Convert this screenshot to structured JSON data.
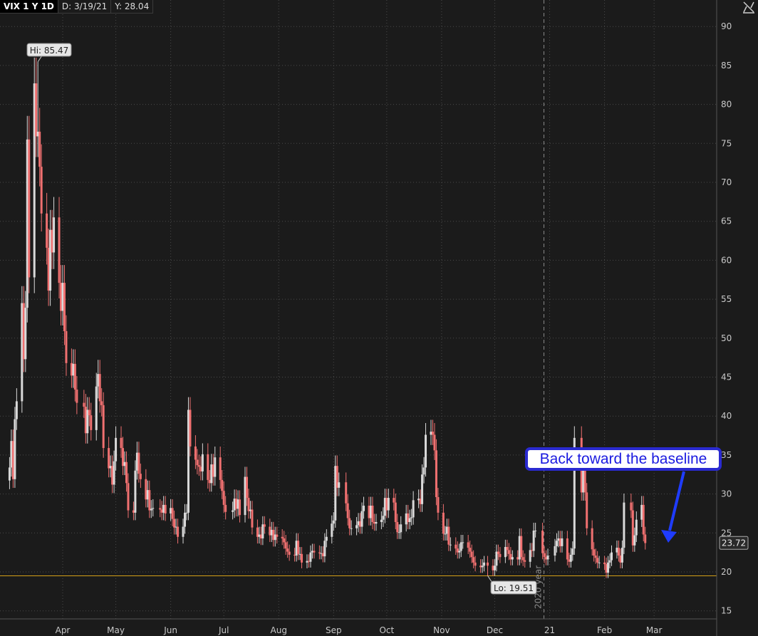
{
  "header": {
    "symbol": "VIX 1 Y 1D",
    "date": "D: 3/19/21",
    "value": "Y: 28.04"
  },
  "annotation": {
    "text": "Back toward the baseline",
    "color": "#1a1ae0"
  },
  "colors": {
    "background": "#1b1b1b",
    "grid": "#4a4a4a",
    "up": "#d9d9d9",
    "down": "#f07070",
    "support_line": "#d4a017",
    "arrow": "#1f3cff"
  },
  "chart_data": {
    "type": "candlestick",
    "title": "VIX 1 Y 1D",
    "xlabel": "",
    "ylabel": "",
    "ylim": [
      14.5,
      92
    ],
    "yticks": [
      15,
      20,
      25,
      30,
      35,
      40,
      45,
      50,
      55,
      60,
      65,
      70,
      75,
      80,
      85,
      90
    ],
    "month_labels": [
      "Apr",
      "May",
      "Jun",
      "Jul",
      "Aug",
      "Sep",
      "Oct",
      "Nov",
      "Dec",
      "21",
      "Feb",
      "Mar"
    ],
    "year_separator_label": "2020 year",
    "grid": true,
    "hi": {
      "label": "Hi: 85.47",
      "value": 85.47,
      "date": "2020-03-18"
    },
    "lo": {
      "label": "Lo: 19.51",
      "value": 19.51,
      "date": "2020-11-27"
    },
    "last_price": {
      "label": "23.72",
      "value": 23.72
    },
    "support_level": 19.5,
    "dates": [
      "2020-03-02",
      "2020-03-03",
      "2020-03-04",
      "2020-03-05",
      "2020-03-06",
      "2020-03-09",
      "2020-03-10",
      "2020-03-11",
      "2020-03-12",
      "2020-03-13",
      "2020-03-16",
      "2020-03-17",
      "2020-03-18",
      "2020-03-19",
      "2020-03-20",
      "2020-03-23",
      "2020-03-24",
      "2020-03-25",
      "2020-03-26",
      "2020-03-27",
      "2020-03-30",
      "2020-03-31",
      "2020-04-01",
      "2020-04-02",
      "2020-04-03",
      "2020-04-06",
      "2020-04-07",
      "2020-04-08",
      "2020-04-09",
      "2020-04-13",
      "2020-04-14",
      "2020-04-15",
      "2020-04-16",
      "2020-04-17",
      "2020-04-20",
      "2020-04-21",
      "2020-04-22",
      "2020-04-23",
      "2020-04-24",
      "2020-04-27",
      "2020-04-28",
      "2020-04-29",
      "2020-04-30",
      "2020-05-01",
      "2020-05-04",
      "2020-05-05",
      "2020-05-06",
      "2020-05-07",
      "2020-05-08",
      "2020-05-11",
      "2020-05-12",
      "2020-05-13",
      "2020-05-14",
      "2020-05-15",
      "2020-05-18",
      "2020-05-19",
      "2020-05-20",
      "2020-05-21",
      "2020-05-22",
      "2020-05-26",
      "2020-05-27",
      "2020-05-28",
      "2020-05-29",
      "2020-06-01",
      "2020-06-02",
      "2020-06-03",
      "2020-06-04",
      "2020-06-05",
      "2020-06-08",
      "2020-06-09",
      "2020-06-10",
      "2020-06-11",
      "2020-06-12",
      "2020-06-15",
      "2020-06-16",
      "2020-06-17",
      "2020-06-18",
      "2020-06-19",
      "2020-06-22",
      "2020-06-23",
      "2020-06-24",
      "2020-06-25",
      "2020-06-26",
      "2020-06-29",
      "2020-06-30",
      "2020-07-01",
      "2020-07-02",
      "2020-07-06",
      "2020-07-07",
      "2020-07-08",
      "2020-07-09",
      "2020-07-10",
      "2020-07-13",
      "2020-07-14",
      "2020-07-15",
      "2020-07-16",
      "2020-07-17",
      "2020-07-20",
      "2020-07-21",
      "2020-07-22",
      "2020-07-23",
      "2020-07-24",
      "2020-07-27",
      "2020-07-28",
      "2020-07-29",
      "2020-07-30",
      "2020-07-31",
      "2020-08-03",
      "2020-08-04",
      "2020-08-05",
      "2020-08-06",
      "2020-08-07",
      "2020-08-10",
      "2020-08-11",
      "2020-08-12",
      "2020-08-13",
      "2020-08-14",
      "2020-08-17",
      "2020-08-18",
      "2020-08-19",
      "2020-08-20",
      "2020-08-21",
      "2020-08-24",
      "2020-08-25",
      "2020-08-26",
      "2020-08-27",
      "2020-08-28",
      "2020-08-31",
      "2020-09-01",
      "2020-09-02",
      "2020-09-03",
      "2020-09-04",
      "2020-09-08",
      "2020-09-09",
      "2020-09-10",
      "2020-09-11",
      "2020-09-14",
      "2020-09-15",
      "2020-09-16",
      "2020-09-17",
      "2020-09-18",
      "2020-09-21",
      "2020-09-22",
      "2020-09-23",
      "2020-09-24",
      "2020-09-25",
      "2020-09-28",
      "2020-09-29",
      "2020-09-30",
      "2020-10-01",
      "2020-10-02",
      "2020-10-05",
      "2020-10-06",
      "2020-10-07",
      "2020-10-08",
      "2020-10-09",
      "2020-10-12",
      "2020-10-13",
      "2020-10-14",
      "2020-10-15",
      "2020-10-16",
      "2020-10-19",
      "2020-10-20",
      "2020-10-21",
      "2020-10-22",
      "2020-10-23",
      "2020-10-26",
      "2020-10-27",
      "2020-10-28",
      "2020-10-29",
      "2020-10-30",
      "2020-11-02",
      "2020-11-03",
      "2020-11-04",
      "2020-11-05",
      "2020-11-06",
      "2020-11-09",
      "2020-11-10",
      "2020-11-11",
      "2020-11-12",
      "2020-11-13",
      "2020-11-16",
      "2020-11-17",
      "2020-11-18",
      "2020-11-19",
      "2020-11-20",
      "2020-11-23",
      "2020-11-24",
      "2020-11-25",
      "2020-11-27",
      "2020-11-30",
      "2020-12-01",
      "2020-12-02",
      "2020-12-03",
      "2020-12-04",
      "2020-12-07",
      "2020-12-08",
      "2020-12-09",
      "2020-12-10",
      "2020-12-11",
      "2020-12-14",
      "2020-12-15",
      "2020-12-16",
      "2020-12-17",
      "2020-12-18",
      "2020-12-21",
      "2020-12-22",
      "2020-12-23",
      "2020-12-24",
      "2020-12-28",
      "2020-12-29",
      "2020-12-30",
      "2020-12-31",
      "2021-01-04",
      "2021-01-05",
      "2021-01-06",
      "2021-01-07",
      "2021-01-08",
      "2021-01-11",
      "2021-01-12",
      "2021-01-13",
      "2021-01-14",
      "2021-01-15",
      "2021-01-19",
      "2021-01-20",
      "2021-01-21",
      "2021-01-22",
      "2021-01-25",
      "2021-01-26",
      "2021-01-27",
      "2021-01-28",
      "2021-01-29",
      "2021-02-01",
      "2021-02-02",
      "2021-02-03",
      "2021-02-04",
      "2021-02-05",
      "2021-02-08",
      "2021-02-09",
      "2021-02-10",
      "2021-02-11",
      "2021-02-12",
      "2021-02-16",
      "2021-02-17",
      "2021-02-18",
      "2021-02-19",
      "2021-02-22",
      "2021-02-23",
      "2021-02-24",
      "2021-02-25",
      "2021-02-26",
      "2021-03-01",
      "2021-03-02",
      "2021-03-03",
      "2021-03-04",
      "2021-03-05"
    ],
    "close": [
      33.4,
      36.8,
      31.9,
      39.6,
      41.9,
      54.5,
      47.3,
      53.9,
      75.5,
      57.8,
      82.7,
      75.9,
      76.5,
      72.0,
      66.0,
      61.6,
      56.1,
      63.9,
      61.0,
      65.5,
      57.1,
      53.5,
      57.1,
      50.9,
      46.8,
      45.2,
      46.7,
      43.4,
      41.7,
      41.2,
      37.8,
      40.8,
      40.1,
      38.2,
      43.8,
      45.4,
      41.9,
      41.4,
      35.9,
      33.3,
      33.6,
      31.2,
      34.2,
      37.2,
      35.9,
      33.6,
      34.1,
      31.4,
      27.9,
      27.6,
      33.0,
      35.3,
      32.6,
      31.9,
      29.3,
      30.5,
      27.9,
      28.1,
      28.2,
      28.0,
      27.6,
      28.6,
      27.5,
      28.2,
      26.8,
      25.7,
      25.8,
      24.5,
      25.8,
      27.6,
      27.6,
      40.8,
      36.1,
      34.4,
      33.7,
      33.5,
      32.9,
      35.1,
      31.8,
      31.4,
      33.8,
      32.2,
      34.7,
      31.8,
      30.4,
      28.6,
      27.7,
      27.9,
      29.4,
      28.1,
      29.3,
      27.3,
      32.2,
      29.5,
      27.8,
      28.0,
      25.7,
      24.5,
      24.8,
      24.3,
      26.1,
      25.8,
      24.7,
      25.4,
      24.1,
      24.8,
      24.5,
      24.3,
      23.8,
      23.0,
      22.6,
      22.2,
      22.1,
      24.0,
      22.3,
      22.3,
      21.2,
      21.4,
      21.3,
      22.5,
      22.7,
      22.5,
      22.4,
      22.4,
      22.0,
      24.0,
      24.5,
      26.2,
      26.6,
      33.6,
      30.8,
      31.5,
      28.8,
      26.9,
      25.6,
      25.6,
      26.0,
      26.5,
      25.8,
      27.8,
      28.5,
      26.9,
      28.5,
      26.4,
      26.2,
      26.4,
      26.7,
      27.2,
      29.5,
      27.9,
      29.5,
      28.9,
      26.4,
      25.1,
      25.1,
      26.1,
      27.5,
      26.4,
      26.9,
      27.0,
      29.2,
      29.4,
      28.7,
      32.5,
      33.4,
      37.6,
      38.0,
      37.6,
      35.6,
      29.6,
      27.6,
      24.9,
      24.9,
      25.8,
      23.5,
      23.5,
      23.0,
      22.5,
      22.7,
      23.8,
      23.8,
      23.1,
      22.6,
      21.9,
      21.2,
      20.8,
      20.6,
      20.8,
      21.2,
      20.8,
      20.2,
      20.8,
      22.6,
      22.3,
      21.9,
      23.2,
      22.8,
      22.3,
      21.6,
      21.9,
      21.6,
      24.6,
      21.9,
      21.5,
      21.3,
      22.8,
      22.7,
      25.3,
      25.3,
      22.4,
      21.9,
      21.6,
      22.1,
      23.3,
      24.0,
      24.3,
      23.3,
      24.3,
      21.6,
      21.3,
      22.2,
      23.0,
      37.2,
      30.2,
      33.1,
      30.2,
      25.6,
      22.9,
      22.1,
      21.8,
      21.2,
      21.2,
      21.0,
      19.9,
      21.2,
      21.5,
      22.5,
      23.1,
      22.1,
      21.2,
      23.1,
      28.9,
      27.9,
      23.4,
      24.7,
      26.7,
      28.6,
      24.8,
      23.7
    ]
  }
}
